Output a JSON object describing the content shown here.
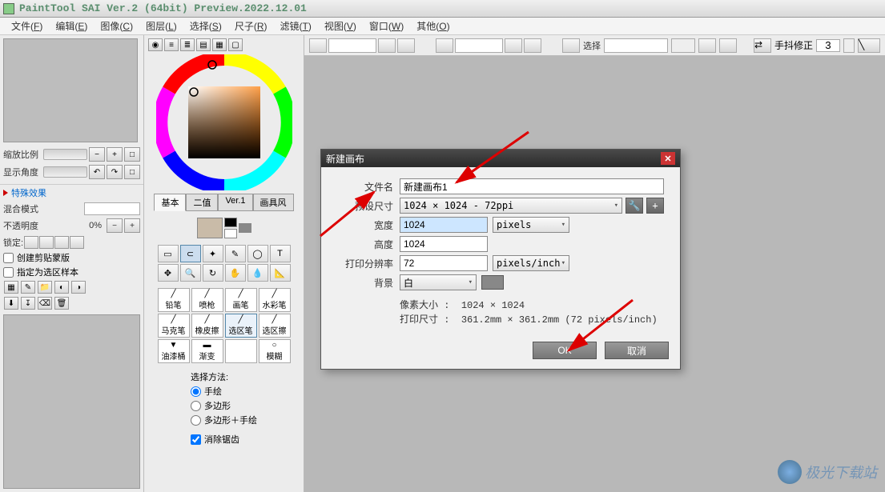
{
  "titlebar": {
    "text": "PaintTool SAI Ver.2 (64bit) Preview.2022.12.01"
  },
  "menubar": {
    "items": [
      {
        "label": "文件",
        "key": "F"
      },
      {
        "label": "编辑",
        "key": "E"
      },
      {
        "label": "图像",
        "key": "C"
      },
      {
        "label": "图层",
        "key": "L"
      },
      {
        "label": "选择",
        "key": "S"
      },
      {
        "label": "尺子",
        "key": "R"
      },
      {
        "label": "滤镜",
        "key": "T"
      },
      {
        "label": "视图",
        "key": "V"
      },
      {
        "label": "窗口",
        "key": "W"
      },
      {
        "label": "其他",
        "key": "O"
      }
    ]
  },
  "left_panel": {
    "zoom_label": "缩放比例",
    "angle_label": "显示角度",
    "angle_reset": "□",
    "special_fx": "特殊效果",
    "blend_label": "混合模式",
    "opacity_label": "不透明度",
    "opacity_val": "0%",
    "lock_label": "锁定:",
    "clip_label": "创建剪贴蒙版",
    "sel_src_label": "指定为选区样本"
  },
  "mid_panel": {
    "tabs": [
      "基本",
      "二值",
      "Ver.1",
      "画具风"
    ],
    "brushes": [
      "铅笔",
      "喷枪",
      "画笔",
      "水彩笔",
      "马克笔",
      "橡皮擦",
      "选区笔",
      "选区擦",
      "油漆桶",
      "渐变",
      "",
      "模糊"
    ],
    "sel_header": "选择方法:",
    "sel_methods": [
      "手绘",
      "多边形",
      "多边形＋手绘"
    ],
    "antialias": "消除锯齿"
  },
  "canvas_toolbar": {
    "select_label": "选择",
    "hand_fix_label": "手抖修正",
    "hand_fix_val": "3"
  },
  "dialog": {
    "title": "新建画布",
    "filename_label": "文件名",
    "filename_val": "新建画布1",
    "preset_label": "预设尺寸",
    "preset_val": "1024 × 1024 - 72ppi",
    "width_label": "宽度",
    "width_val": "1024",
    "width_unit": "pixels",
    "height_label": "高度",
    "height_val": "1024",
    "res_label": "打印分辨率",
    "res_val": "72",
    "res_unit": "pixels/inch",
    "bg_label": "背景",
    "bg_val": "白",
    "pixelsize_label": "像素大小 :",
    "pixelsize_val": "1024 × 1024",
    "printsize_label": "打印尺寸 :",
    "printsize_val": "361.2mm × 361.2mm (72 pixels/inch)",
    "ok": "OK",
    "cancel": "取消"
  },
  "watermark": "极光下载站"
}
